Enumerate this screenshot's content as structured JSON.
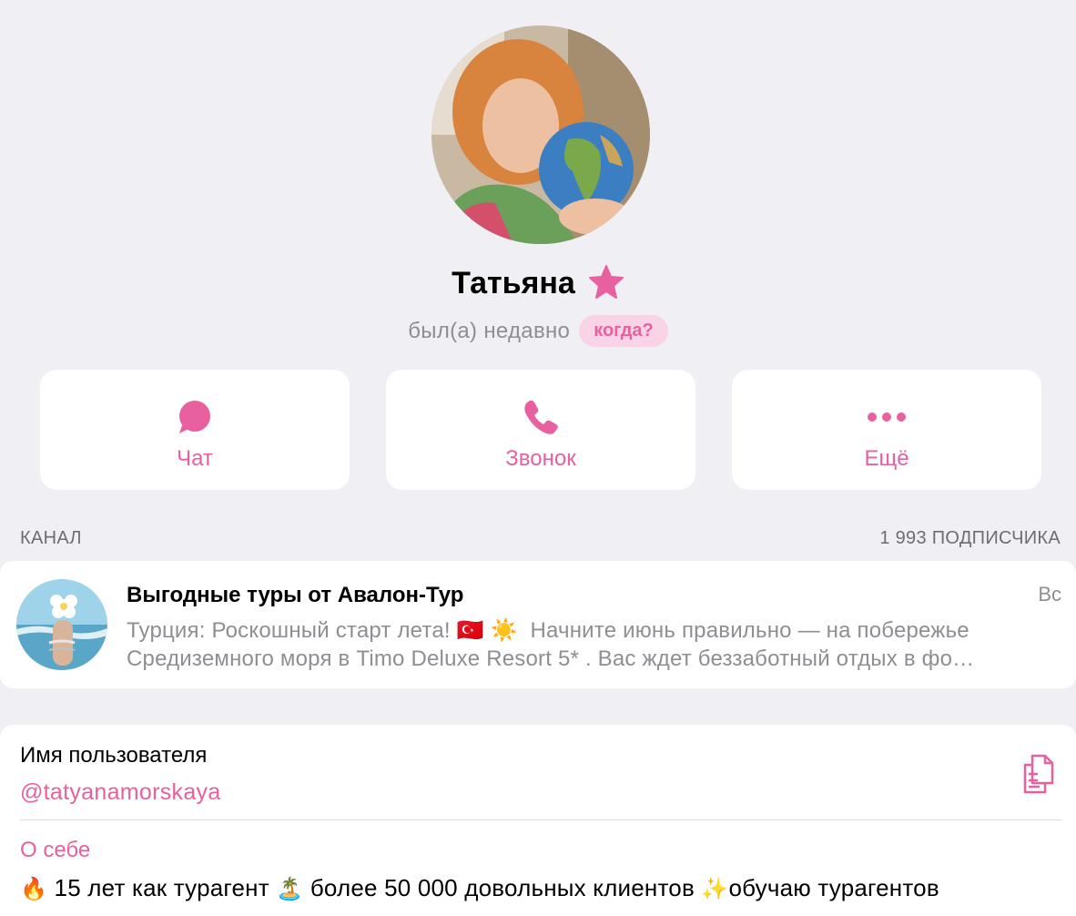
{
  "profile": {
    "name": "Татьяна",
    "status": "был(а) недавно",
    "when_label": "когда?"
  },
  "actions": [
    {
      "label": "Чат",
      "icon": "chat-bubble-icon"
    },
    {
      "label": "Звонок",
      "icon": "phone-icon"
    },
    {
      "label": "Ещё",
      "icon": "more-dots-icon"
    }
  ],
  "channel_section": {
    "header": "КАНАЛ",
    "subscribers": "1 993 ПОДПИСЧИКА"
  },
  "channel": {
    "title": "Выгодные туры от Авалон-Тур",
    "date": "Вс",
    "line1_part1": "Турция: Роскошный старт лета!",
    "line1_emoji1": "🇹🇷",
    "line1_emoji2": "☀️",
    "line1_part2": "Начните июнь правильно — на побережье",
    "line2": "Средиземного моря в Timo Deluxe Resort 5* . Вас ждет беззаботный отдых в фо…"
  },
  "info": {
    "username_label": "Имя пользователя",
    "username": "@tatyanamorskaya",
    "about_label": "О себе",
    "about_emoji1": "🔥",
    "about_part1": "15 лет как турагент",
    "about_emoji2": "🏝️",
    "about_part2": "более 50 000 довольных клиентов",
    "about_emoji3": "✨",
    "about_part3": "обучаю турагентов"
  },
  "colors": {
    "accent": "#e8609f",
    "background": "#efeff4",
    "card": "#ffffff",
    "secondary_text": "#8e8e93"
  }
}
